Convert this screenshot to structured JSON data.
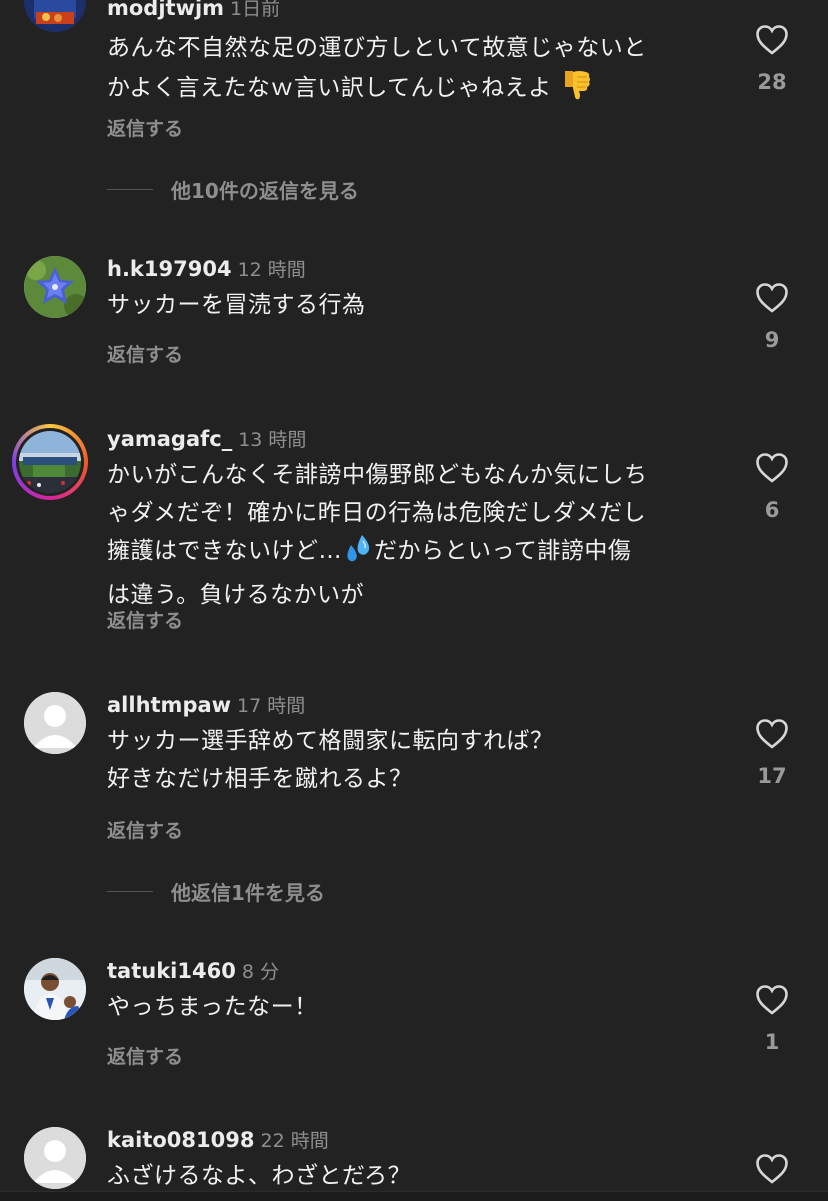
{
  "colors": {
    "background": "#222222",
    "text": "#ececec",
    "muted": "#8e8e8e"
  },
  "comments": [
    {
      "username": "modjtwjm",
      "time": "1日前",
      "text_line1": "あんな不自然な足の運び方しといて故意じゃないと",
      "text_line2": "かよく言えたなｗ言い訳してんじゃねえよ",
      "emoji": "thumbs-down-emoji",
      "reply_label": "返信する",
      "likes": "28"
    },
    {
      "username": "h.k197904",
      "time": "12 時間",
      "text": "サッカーを冒涜する行為",
      "reply_label": "返信する",
      "likes": "9"
    },
    {
      "username": "yamagafc_",
      "time": "13 時間",
      "text_line1": "かいがこんなくそ誹謗中傷野郎どもなんか気にしち",
      "text_line2": "ゃダメだぞ！確かに昨日の行為は危険だしダメだし",
      "text_line3a": "擁護はできないけど…",
      "emoji": "sweat-droplets-emoji",
      "text_line3b": "だからといって誹謗中傷",
      "text_line4": "は違う。負けるなかいが",
      "reply_label": "返信する",
      "likes": "6"
    },
    {
      "username": "allhtmpaw",
      "time": "17 時間",
      "text_line1": "サッカー選手辞めて格闘家に転向すれば？",
      "text_line2": "好きなだけ相手を蹴れるよ？",
      "reply_label": "返信する",
      "likes": "17"
    },
    {
      "username": "tatuki1460",
      "time": "8 分",
      "text": "やっちまったなー！",
      "reply_label": "返信する",
      "likes": "1"
    },
    {
      "username": "kaito081098",
      "time": "22 時間",
      "text": "ふざけるなよ、わざとだろ？"
    }
  ],
  "more_replies": [
    {
      "label": "他10件の返信を見る"
    },
    {
      "label": "他返信1件を見る"
    }
  ]
}
